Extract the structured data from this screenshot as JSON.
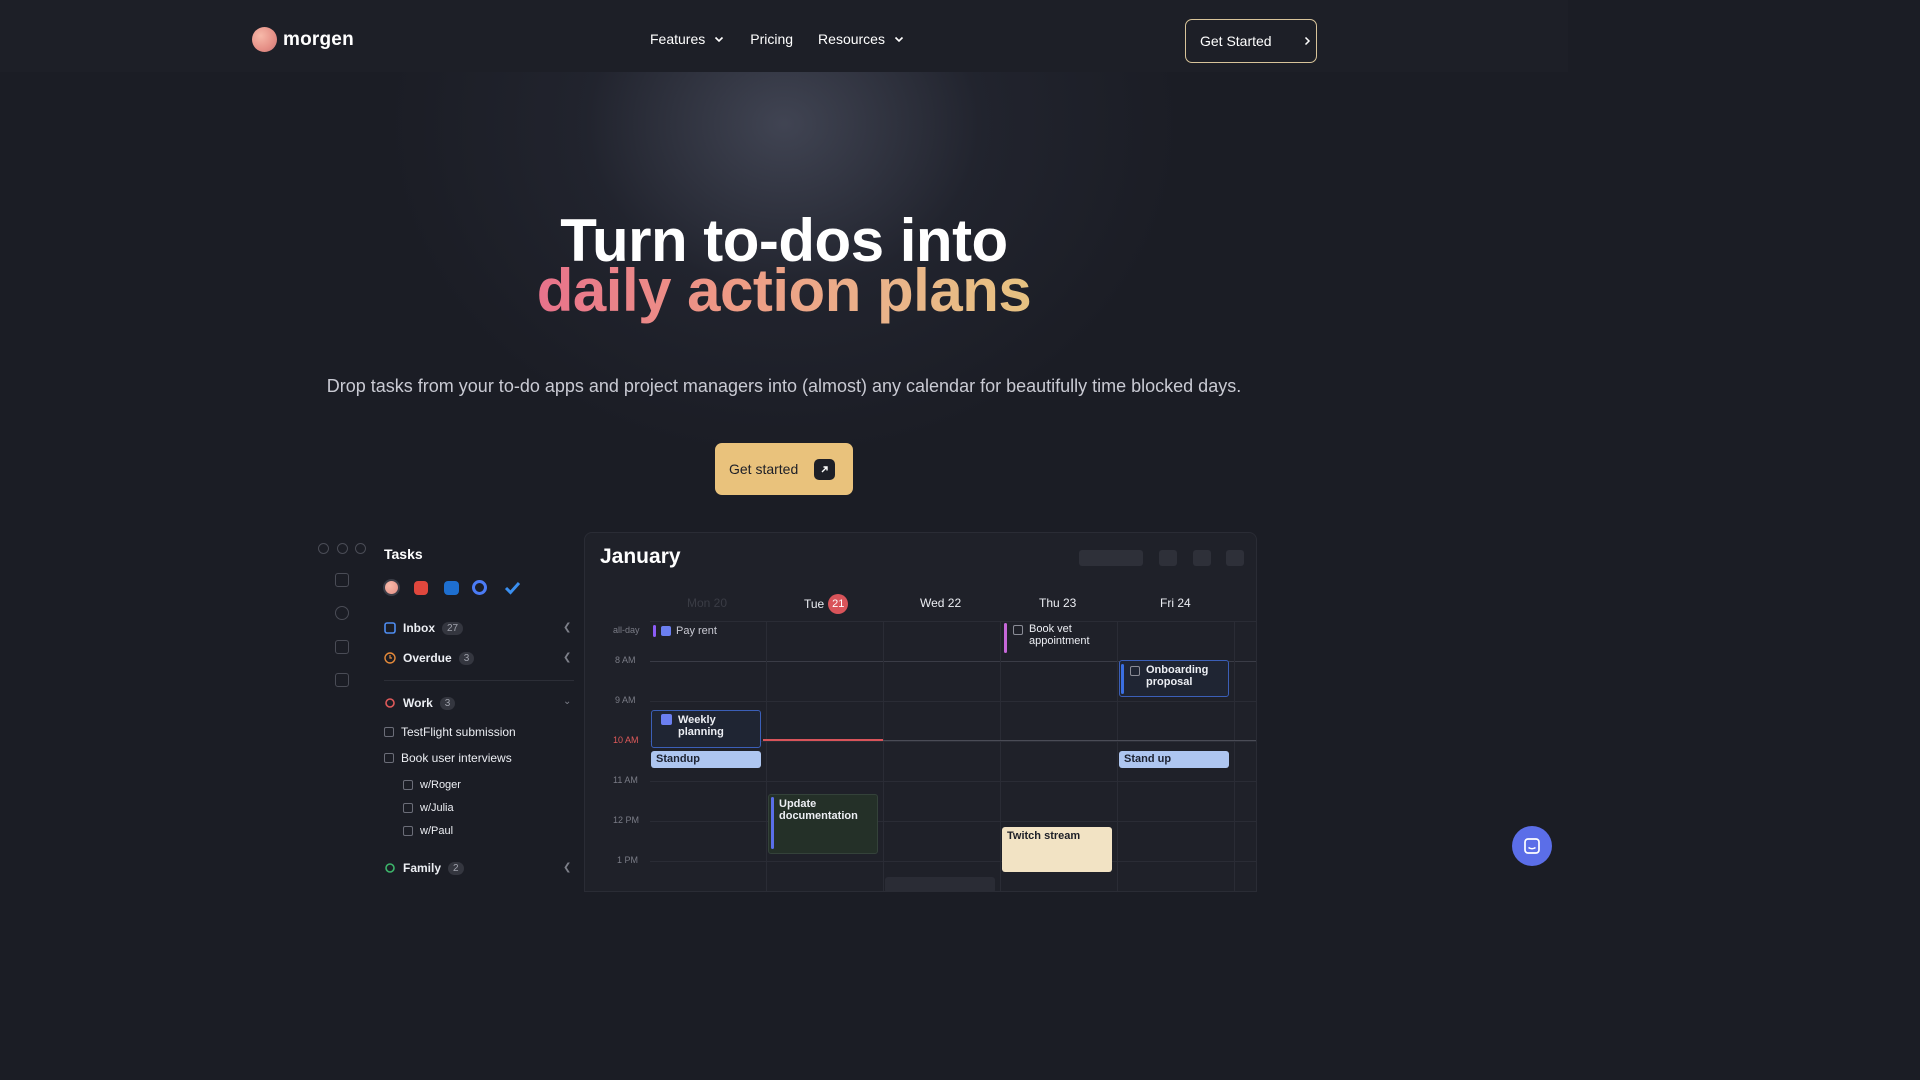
{
  "nav": {
    "brand": "morgen",
    "links": [
      {
        "label": "Features",
        "has_dropdown": true
      },
      {
        "label": "Pricing",
        "has_dropdown": false
      },
      {
        "label": "Resources",
        "has_dropdown": true
      }
    ],
    "cta": "Get Started"
  },
  "hero": {
    "line1": "Turn to-dos into",
    "line2": "daily action plans",
    "subtitle": "Drop tasks from your to-do apps and project managers into (almost) any calendar for beautifully time blocked days.",
    "cta": "Get started"
  },
  "tasks_panel": {
    "title": "Tasks",
    "integrations": [
      "morgen-icon",
      "todoist-icon",
      "outlook-icon",
      "ticktick-icon",
      "microsoft-todo-icon"
    ],
    "groups": [
      {
        "label": "Inbox",
        "count": "27"
      },
      {
        "label": "Overdue",
        "count": "3"
      }
    ],
    "work": {
      "label": "Work",
      "count": "3",
      "items": [
        "TestFlight submission",
        "Book user interviews"
      ],
      "subitems": [
        "w/Roger",
        "w/Julia",
        "w/Paul"
      ]
    },
    "family": {
      "label": "Family",
      "count": "2"
    }
  },
  "calendar": {
    "month": "January",
    "days": [
      "Mon 20",
      "Tue",
      "Wed 22",
      "Thu 23",
      "Fri 24"
    ],
    "today_number": "21",
    "times": [
      "all-day",
      "8 AM",
      "9 AM",
      "10 AM",
      "11 AM",
      "12 PM",
      "1 PM"
    ],
    "events": {
      "pay_rent": "Pay rent",
      "vet": "Book vet appointment",
      "onboarding": "Onboarding proposal",
      "weekly": "Weekly planning",
      "standup": "Standup",
      "standup2": "Stand up",
      "docs": "Update documentation",
      "twitch": "Twitch stream"
    }
  },
  "colors": {
    "background": "#1b1d25",
    "accent": "#e9c27c",
    "gradient_start": "#e8728b",
    "gradient_end": "#e7c281",
    "today": "#d9545a"
  }
}
